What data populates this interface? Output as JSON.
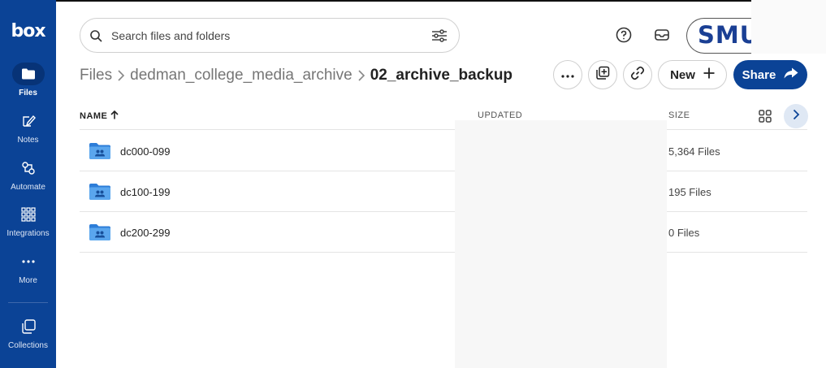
{
  "sidebar": {
    "logo": "box",
    "items": [
      {
        "label": "Files",
        "icon": "folder-icon",
        "active": true
      },
      {
        "label": "Notes",
        "icon": "notes-icon",
        "active": false
      },
      {
        "label": "Automate",
        "icon": "automate-icon",
        "active": false
      },
      {
        "label": "Integrations",
        "icon": "integrations-grid-icon",
        "active": false
      },
      {
        "label": "More",
        "icon": "more-dots-icon",
        "active": false
      },
      {
        "label": "Collections",
        "icon": "collections-icon",
        "active": false
      }
    ]
  },
  "header": {
    "search_placeholder": "Search files and folders",
    "avatar_text": "SMU"
  },
  "breadcrumb": {
    "items": [
      "Files",
      "dedman_college_media_archive"
    ],
    "current": "02_archive_backup"
  },
  "toolbar": {
    "new_label": "New",
    "share_label": "Share"
  },
  "table": {
    "columns": {
      "name": "NAME",
      "updated": "UPDATED",
      "size": "SIZE"
    },
    "rows": [
      {
        "name": "dc000-099",
        "size": "5,364 Files"
      },
      {
        "name": "dc100-199",
        "size": "195 Files"
      },
      {
        "name": "dc200-299",
        "size": "0 Files"
      }
    ]
  },
  "colors": {
    "brand": "#0b4396",
    "folder": "#3d8de0"
  }
}
